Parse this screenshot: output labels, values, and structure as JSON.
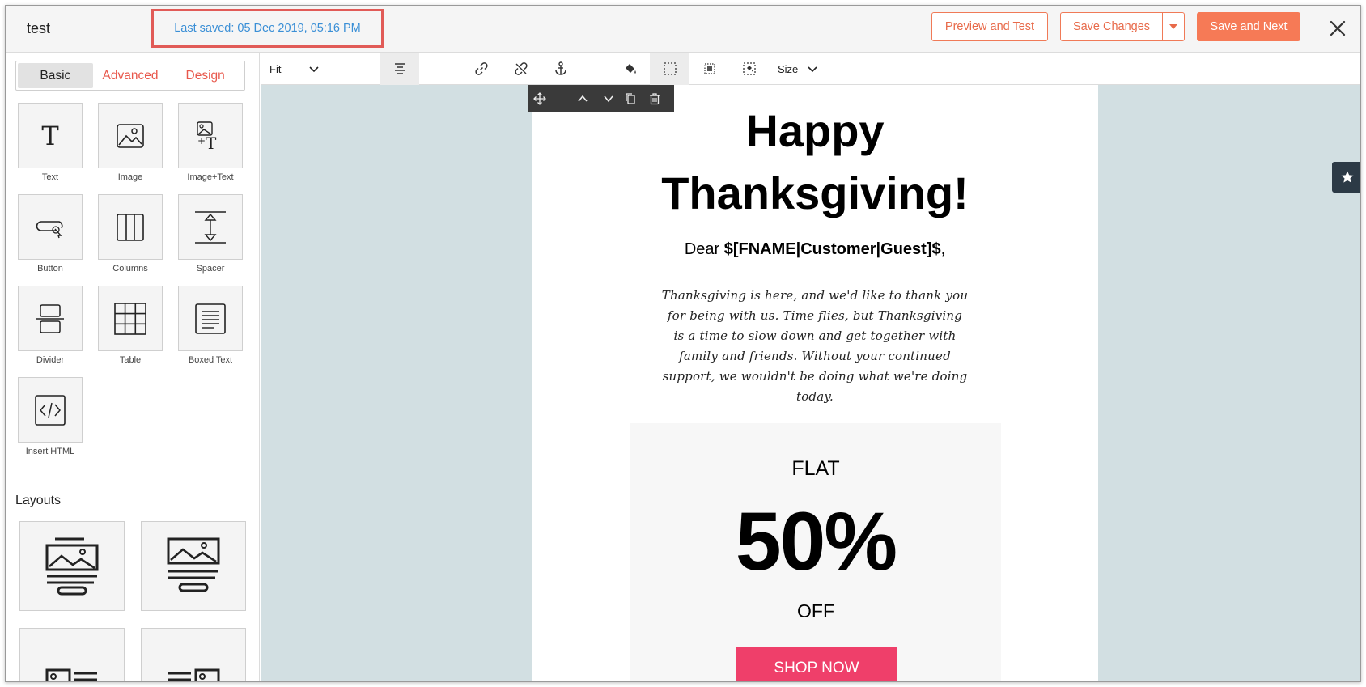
{
  "header": {
    "title": "test",
    "last_saved": "Last saved: 05 Dec 2019, 05:16 PM",
    "preview_label": "Preview and Test",
    "save_label": "Save Changes",
    "save_next_label": "Save and Next"
  },
  "sidebar": {
    "tabs": [
      {
        "label": "Basic",
        "active": true
      },
      {
        "label": "Advanced",
        "active": false
      },
      {
        "label": "Design",
        "active": false
      }
    ],
    "blocks": [
      {
        "label": "Text",
        "icon": "text-icon"
      },
      {
        "label": "Image",
        "icon": "image-icon"
      },
      {
        "label": "Image+Text",
        "icon": "image-text-icon"
      },
      {
        "label": "Button",
        "icon": "button-icon"
      },
      {
        "label": "Columns",
        "icon": "columns-icon"
      },
      {
        "label": "Spacer",
        "icon": "spacer-icon"
      },
      {
        "label": "Divider",
        "icon": "divider-icon"
      },
      {
        "label": "Table",
        "icon": "table-icon"
      },
      {
        "label": "Boxed Text",
        "icon": "boxed-text-icon"
      },
      {
        "label": "Insert HTML",
        "icon": "code-icon"
      }
    ],
    "layouts_title": "Layouts"
  },
  "toolbar": {
    "fit_label": "Fit",
    "size_label": "Size"
  },
  "email": {
    "headline_line1": "Happy",
    "headline_line2": "Thanksgiving!",
    "greeting_prefix": "Dear ",
    "greeting_tag": "$[FNAME|Customer|Guest]$",
    "greeting_suffix": ",",
    "body": "Thanksgiving is here, and we'd like to thank you for being with us. Time flies, but Thanksgiving is a time to slow down and get together with family and friends. Without your continued support, we wouldn't be doing what we're doing today.",
    "offer_top": "FLAT",
    "offer_value": "50%",
    "offer_bottom": "OFF",
    "cta": "SHOP NOW"
  },
  "colors": {
    "accent": "#f67a56",
    "tab_inactive": "#e8584c",
    "last_saved_text": "#3a8fd6",
    "highlight_border": "#e15b57",
    "canvas_bg": "#d2dfe2",
    "cta_bg": "#ef3f6a"
  }
}
